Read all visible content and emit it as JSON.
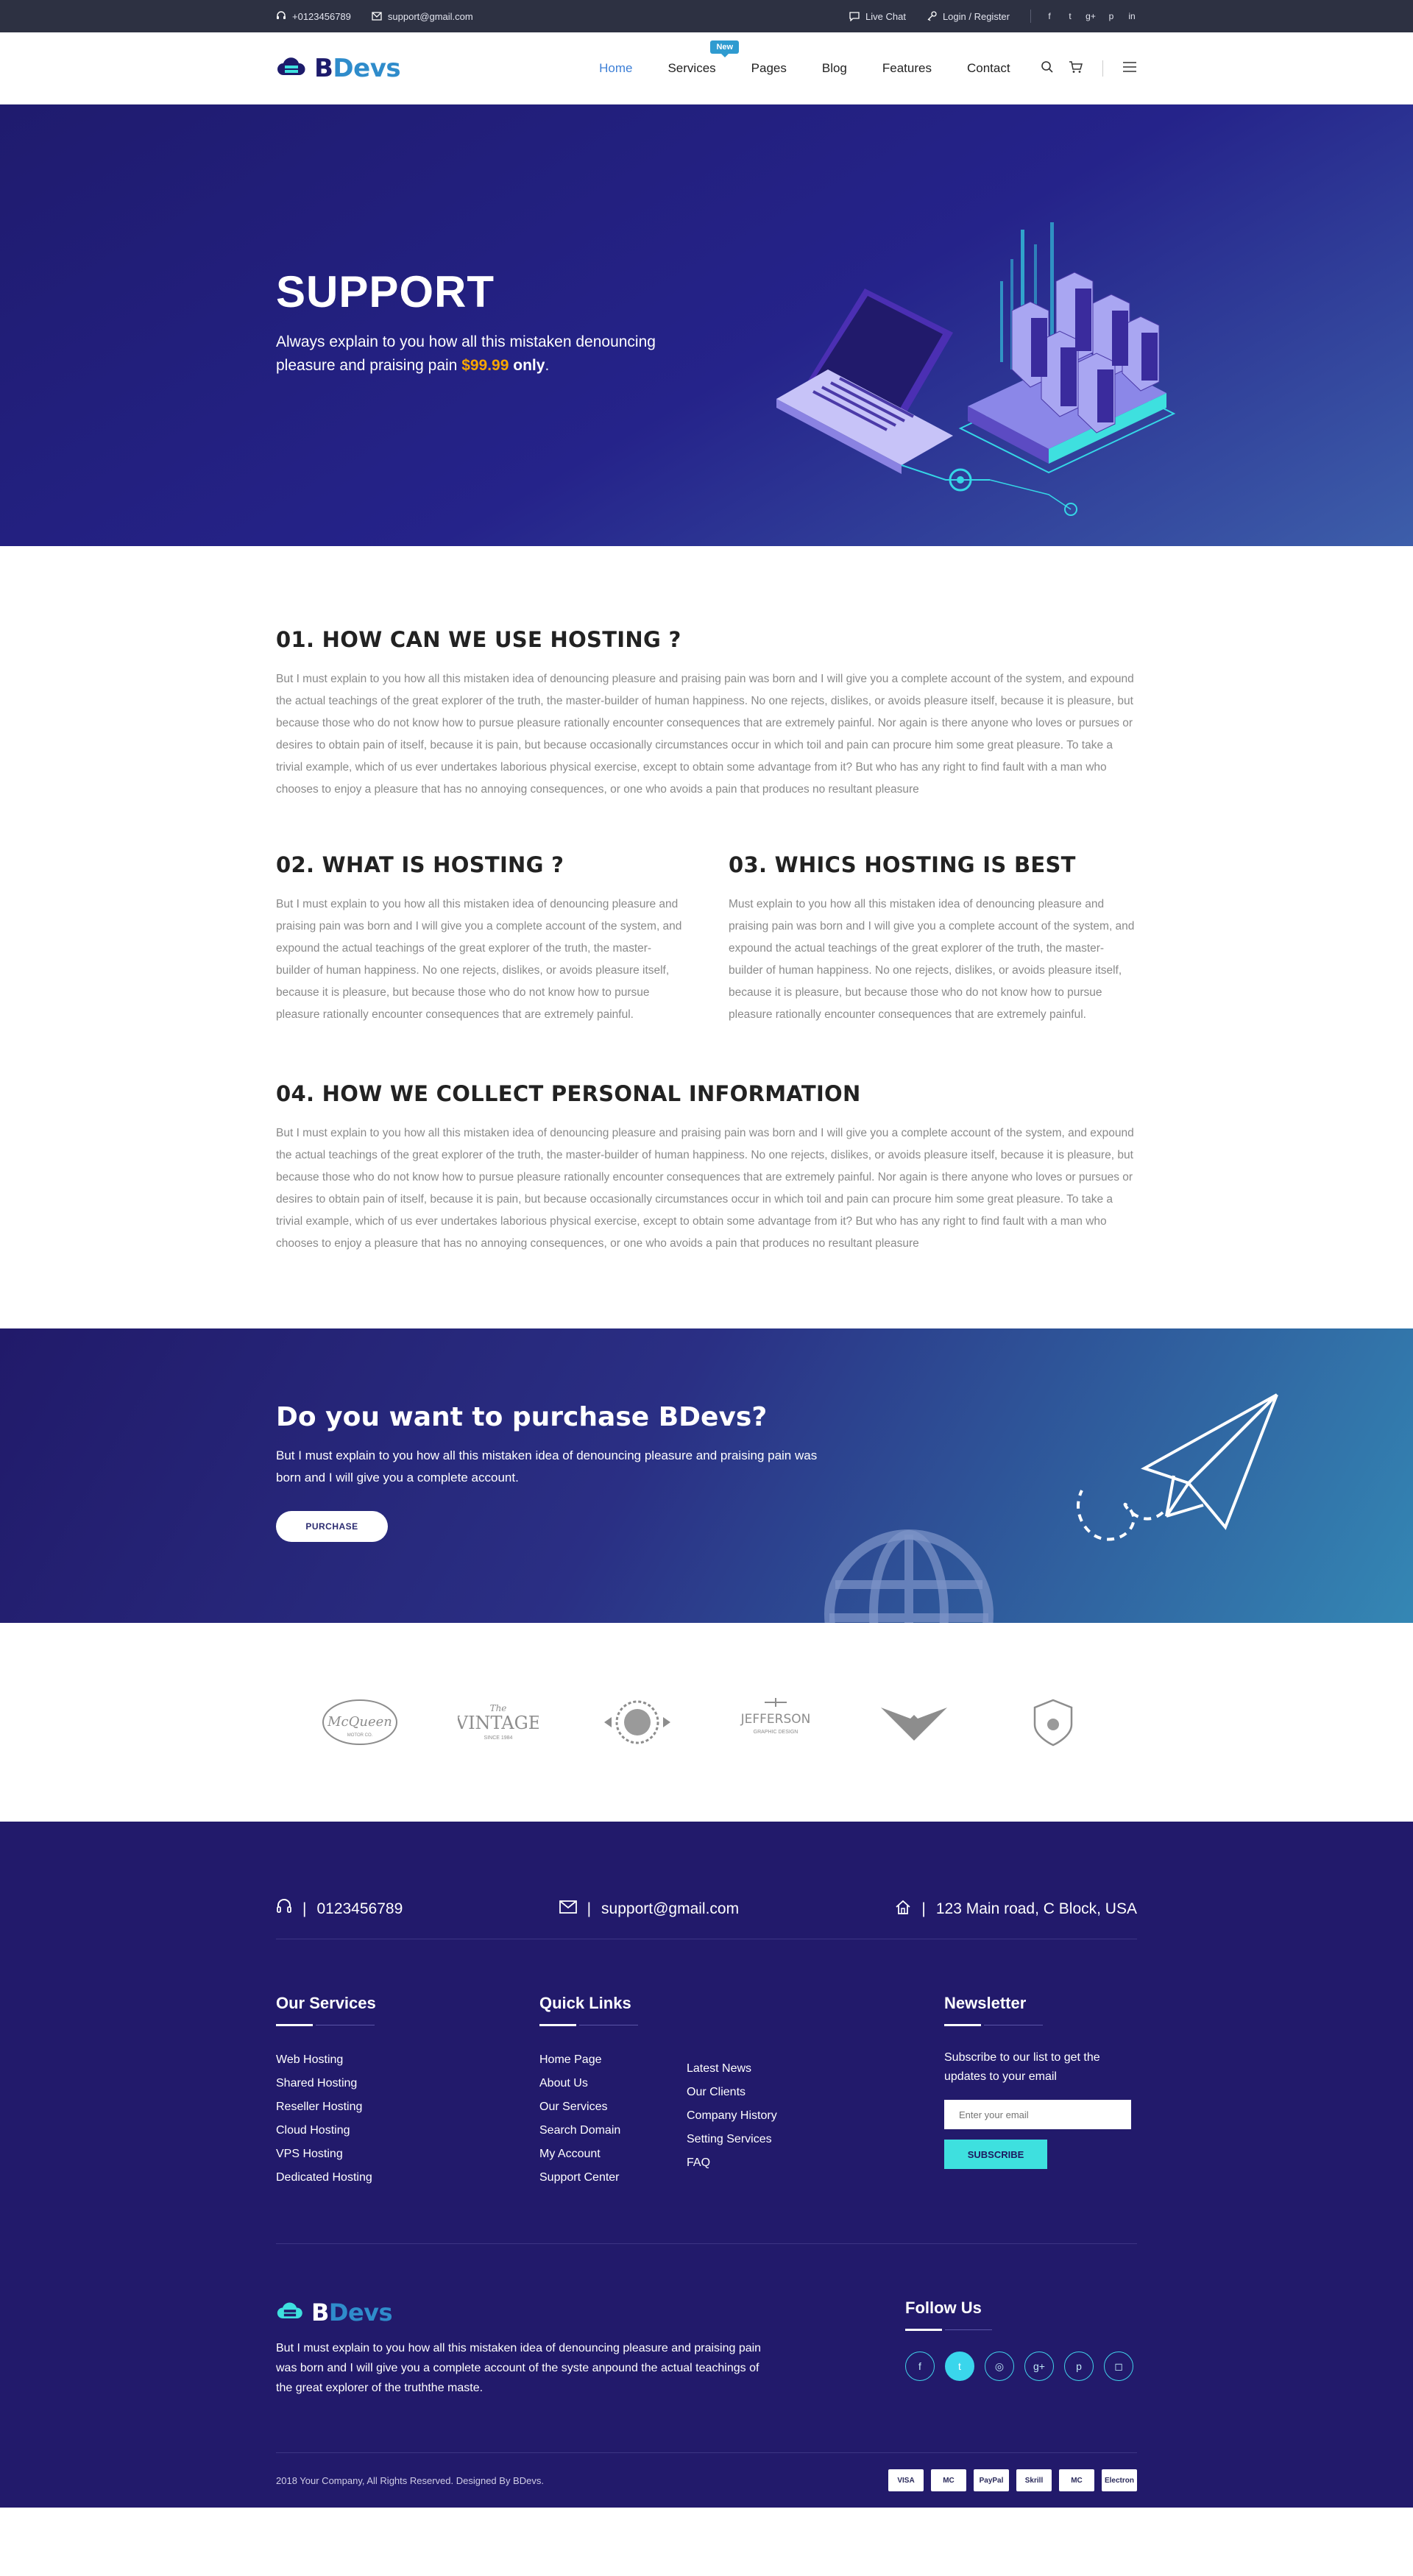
{
  "topbar": {
    "phone": "+0123456789",
    "email": "support@gmail.com",
    "live_chat": "Live Chat",
    "login": "Login / Register",
    "socials": [
      "f",
      "t",
      "g+",
      "p",
      "in"
    ]
  },
  "header": {
    "logo_b": "B",
    "logo_rest": "Devs",
    "nav": [
      {
        "label": "Home",
        "active": true
      },
      {
        "label": "Services",
        "badge": "New"
      },
      {
        "label": "Pages"
      },
      {
        "label": "Blog"
      },
      {
        "label": "Features"
      },
      {
        "label": "Contact"
      }
    ]
  },
  "hero": {
    "title": "SUPPORT",
    "sub_line": "Always explain to you how all this mistaken denouncing pleasure and praising pain ",
    "price": "$99.99",
    "only": " only",
    "period": "."
  },
  "sections": {
    "s1": {
      "title": "01. HOW CAN WE USE HOSTING ?",
      "text": "But I must explain to you how all this mistaken idea of denouncing pleasure and praising pain was born and I will give you a complete account of the system, and expound the actual teachings of the great explorer of the truth, the master-builder of human happiness. No one rejects, dislikes, or avoids pleasure itself, because it is pleasure, but because those who do not know how to pursue pleasure rationally encounter consequences that are extremely painful. Nor again is there anyone who loves or pursues or desires to obtain pain of itself, because it is pain, but because occasionally circumstances occur in which toil and pain can procure him some great pleasure. To take a trivial example, which of us ever undertakes laborious physical exercise, except to obtain some advantage from it? But who has any right to find fault with a man who chooses to enjoy a pleasure that has no annoying consequences, or one who avoids a pain that produces no resultant pleasure"
    },
    "s2": {
      "title": "02. WHAT IS  HOSTING ?",
      "text": "But I must explain to you how all this mistaken idea of denouncing pleasure and praising pain was born and I will give you a complete account of the system, and expound the actual teachings of the great explorer of the truth, the master-builder of human happiness. No one rejects, dislikes, or avoids pleasure itself, because it is pleasure, but because those who do not know how to pursue pleasure rationally encounter consequences that are extremely painful."
    },
    "s3": {
      "title": "03. WHICS HOSTING IS BEST",
      "text": "Must explain to you how all this mistaken idea of denouncing pleasure and praising pain was born and I will give you a complete account of the system, and expound the actual teachings of the great explorer of the truth, the master-builder of human happiness. No one rejects, dislikes, or avoids pleasure itself, because it is pleasure, but because those who do not know how to pursue pleasure rationally encounter consequences that are extremely painful."
    },
    "s4": {
      "title": "04. HOW WE COLLECT PERSONAL INFORMATION",
      "text": "But I must explain to you how all this mistaken idea of denouncing pleasure and praising pain was born and I will give you a complete account of the system, and expound the actual teachings of the great explorer of the truth, the master-builder of human happiness. No one rejects, dislikes, or avoids pleasure itself, because it is pleasure, but because those who do not know how to pursue pleasure rationally encounter consequences that are extremely painful. Nor again is there anyone who loves or pursues or desires to obtain pain of itself, because it is pain, but because occasionally circumstances occur in which toil and pain can procure him some great pleasure. To take a trivial example, which of us ever undertakes laborious physical exercise, except to obtain some advantage from it? But who has any right to find fault with a man who chooses to enjoy a pleasure that has no annoying consequences, or one who avoids a pain that produces no resultant pleasure"
    }
  },
  "cta": {
    "title": "Do you want to purchase BDevs?",
    "text": "But I must explain to you how all this mistaken idea of denouncing pleasure and praising pain was born and I will give you a complete account.",
    "button": "PURCHASE"
  },
  "brands": [
    {
      "name": "McQueen",
      "sub": "MOTOR CO."
    },
    {
      "name": "VINTAGE",
      "sub": "SINCE 1984"
    },
    {
      "name": "Brand",
      "sub": ""
    },
    {
      "name": "JEFFERSON",
      "sub": "GRAPHIC DESIGN"
    },
    {
      "name": "eagle",
      "sub": ""
    },
    {
      "name": "shield",
      "sub": ""
    }
  ],
  "footer": {
    "phone": "0123456789",
    "email": "support@gmail.com",
    "address": "123 Main road, C Block, USA",
    "services_title": "Our Services",
    "services": [
      "Web Hosting",
      "Shared Hosting",
      "Reseller Hosting",
      "Cloud Hosting",
      "VPS Hosting",
      "Dedicated Hosting"
    ],
    "quick_title": "Quick Links",
    "quick_a": [
      "Home Page",
      "About Us",
      "Our Services",
      "Search Domain",
      "My Account",
      "Support Center"
    ],
    "quick_b": [
      "Latest News",
      "Our Clients",
      "Company History",
      "Setting Services",
      "FAQ"
    ],
    "newsletter_title": "Newsletter",
    "newsletter_text": "Subscribe to our list to get the updates to your email",
    "email_placeholder": "Enter your email",
    "subscribe": "SUBSCRIBE",
    "about": "But I must explain to you how all this mistaken idea of denouncing pleasure and praising pain was born and I will give you a complete account of the syste anpound the actual teachings of the great explorer of the truththe maste.",
    "follow_title": "Follow Us",
    "copyright": "2018 Your Company, All Rights Reserved. Designed By BDevs.",
    "payments": [
      "VISA",
      "MC",
      "PayPal",
      "Skrill",
      "MC",
      "Electron"
    ]
  },
  "colors": {
    "accent": "#3d7fd6",
    "price": "#f7a600",
    "footer_bg": "#221a6b",
    "cyan": "#3ee0df"
  }
}
